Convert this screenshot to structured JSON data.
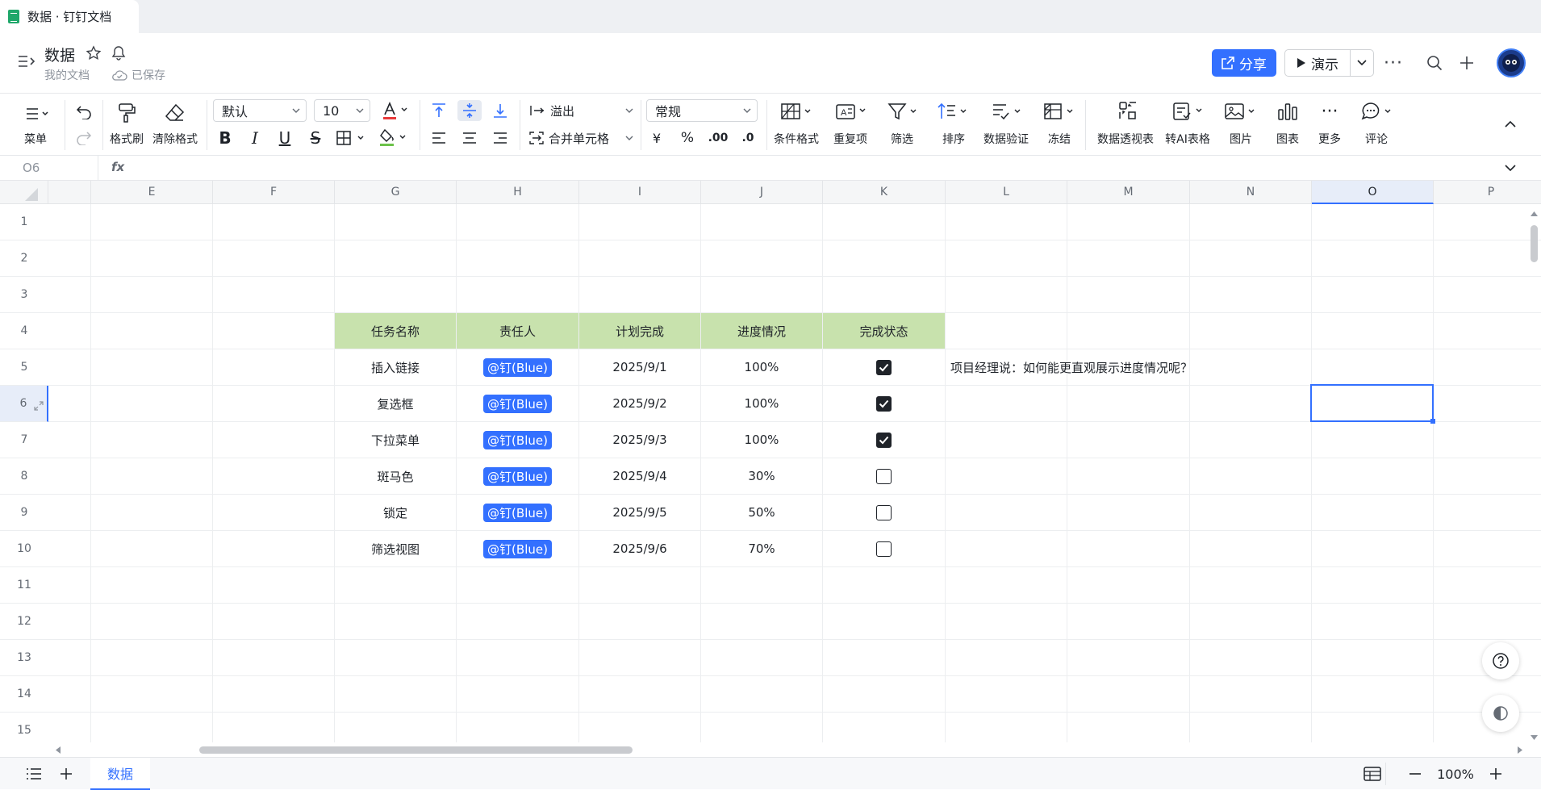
{
  "window": {
    "tab_title": "数据 · 钉钉文档"
  },
  "header": {
    "doc_title": "数据",
    "location": "我的文档",
    "save_status": "已保存",
    "share_label": "分享",
    "present_label": "演示"
  },
  "toolbar": {
    "menu": "菜单",
    "format_painter": "格式刷",
    "clear_format": "清除格式",
    "font_family": "默认",
    "font_size": "10",
    "overflow": "溢出",
    "merge_cells": "合并单元格",
    "number_format": "常规",
    "currency": "¥",
    "percent": "%",
    "decimal_inc": ".00",
    "decimal_dec": ".0",
    "conditional_format": "条件格式",
    "duplicates": "重复项",
    "filter": "筛选",
    "sort": "排序",
    "data_validation": "数据验证",
    "freeze": "冻结",
    "pivot_table": "数据透视表",
    "to_ai_table": "转AI表格",
    "image": "图片",
    "chart": "图表",
    "more": "更多",
    "comment": "评论"
  },
  "formula_bar": {
    "cell_ref": "O6",
    "fx": "fx",
    "value": ""
  },
  "sheet": {
    "columns": [
      "E",
      "F",
      "G",
      "H",
      "I",
      "J",
      "K",
      "L",
      "M",
      "N",
      "O",
      "P"
    ],
    "active_column": "O",
    "rows": [
      "1",
      "2",
      "3",
      "4",
      "5",
      "6",
      "7",
      "8",
      "9",
      "10",
      "11",
      "12",
      "13",
      "14",
      "15"
    ],
    "active_row": "6",
    "table_headers": [
      "任务名称",
      "责任人",
      "计划完成",
      "进度情况",
      "完成状态"
    ],
    "table_rows": [
      {
        "task": "插入链接",
        "owner": "@钉(Blue)",
        "date": "2025/9/1",
        "progress": "100%",
        "done": true
      },
      {
        "task": "复选框",
        "owner": "@钉(Blue)",
        "date": "2025/9/2",
        "progress": "100%",
        "done": true
      },
      {
        "task": "下拉菜单",
        "owner": "@钉(Blue)",
        "date": "2025/9/3",
        "progress": "100%",
        "done": true
      },
      {
        "task": "斑马色",
        "owner": "@钉(Blue)",
        "date": "2025/9/4",
        "progress": "30%",
        "done": false
      },
      {
        "task": "锁定",
        "owner": "@钉(Blue)",
        "date": "2025/9/5",
        "progress": "50%",
        "done": false
      },
      {
        "task": "筛选视图",
        "owner": "@钉(Blue)",
        "date": "2025/9/6",
        "progress": "70%",
        "done": false
      }
    ],
    "note": "项目经理说：如何能更直观展示进度情况呢？",
    "header_fill": "#c8e2ad",
    "accent": "#3370ff"
  },
  "footer": {
    "sheet_name": "数据",
    "zoom": "100%"
  }
}
